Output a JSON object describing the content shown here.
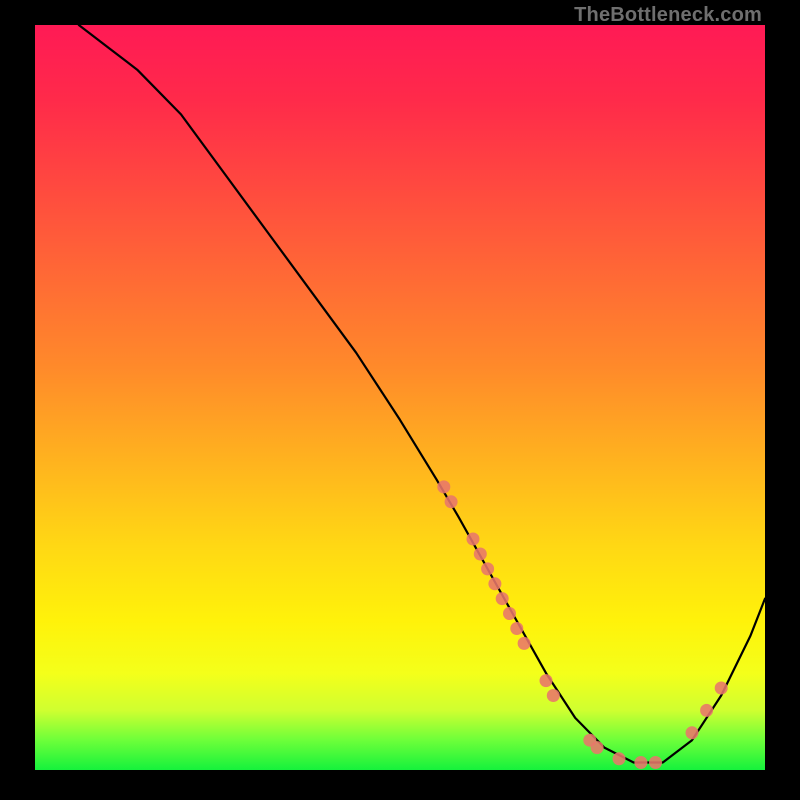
{
  "watermark": "TheBottleneck.com",
  "chart_data": {
    "type": "line",
    "title": "",
    "xlabel": "",
    "ylabel": "",
    "xlim": [
      0,
      100
    ],
    "ylim": [
      0,
      100
    ],
    "grid": false,
    "legend": false,
    "note": "Axes are unlabeled; values are percentages estimated from pixel positions (bottom-left origin).",
    "series": [
      {
        "name": "curve",
        "color": "#000000",
        "x": [
          6,
          10,
          14,
          20,
          26,
          32,
          38,
          44,
          50,
          55,
          58,
          62,
          66,
          70,
          74,
          78,
          82,
          86,
          90,
          94,
          98,
          100
        ],
        "y": [
          100,
          97,
          94,
          88,
          80,
          72,
          64,
          56,
          47,
          39,
          34,
          27,
          20,
          13,
          7,
          3,
          1,
          1,
          4,
          10,
          18,
          23
        ]
      }
    ],
    "markers": {
      "name": "highlighted-points",
      "color": "#e8766b",
      "note": "Points lying on the curve; clustered on the descending slope around x≈56–70 and a few on the ascending tail x≈88–94.",
      "points": [
        {
          "x": 56,
          "y": 38
        },
        {
          "x": 57,
          "y": 36
        },
        {
          "x": 60,
          "y": 31
        },
        {
          "x": 61,
          "y": 29
        },
        {
          "x": 62,
          "y": 27
        },
        {
          "x": 63,
          "y": 25
        },
        {
          "x": 64,
          "y": 23
        },
        {
          "x": 65,
          "y": 21
        },
        {
          "x": 66,
          "y": 19
        },
        {
          "x": 67,
          "y": 17
        },
        {
          "x": 70,
          "y": 12
        },
        {
          "x": 71,
          "y": 10
        },
        {
          "x": 76,
          "y": 4
        },
        {
          "x": 77,
          "y": 3
        },
        {
          "x": 80,
          "y": 1.5
        },
        {
          "x": 83,
          "y": 1
        },
        {
          "x": 85,
          "y": 1
        },
        {
          "x": 90,
          "y": 5
        },
        {
          "x": 92,
          "y": 8
        },
        {
          "x": 94,
          "y": 11
        }
      ]
    },
    "background_gradient": {
      "direction": "vertical",
      "stops": [
        {
          "pos": 0.0,
          "color": "#ff1a55"
        },
        {
          "pos": 0.35,
          "color": "#ff6a35"
        },
        {
          "pos": 0.7,
          "color": "#ffd814"
        },
        {
          "pos": 0.9,
          "color": "#cfff30"
        },
        {
          "pos": 1.0,
          "color": "#15f23c"
        }
      ]
    }
  }
}
